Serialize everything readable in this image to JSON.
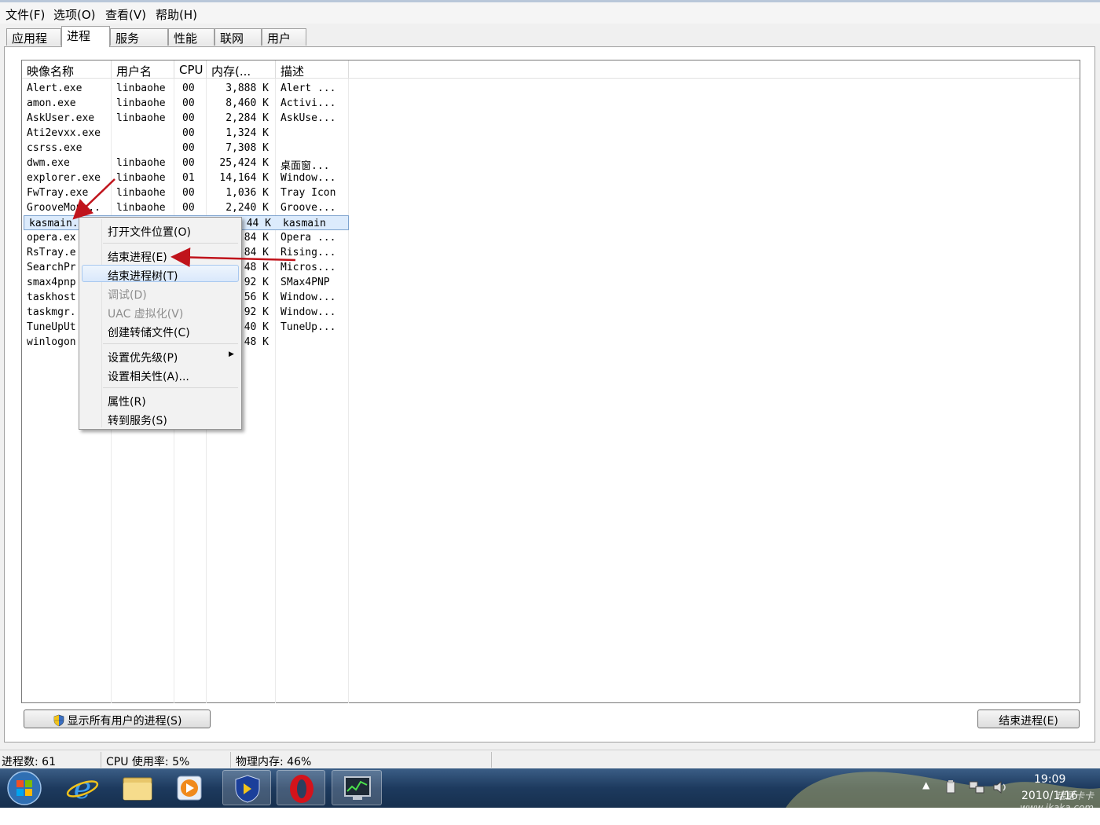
{
  "menubar": {
    "file": "文件(F)",
    "options": "选项(O)",
    "view": "查看(V)",
    "help": "帮助(H)"
  },
  "tabs": [
    {
      "label": "应用程序"
    },
    {
      "label": "进程",
      "active": true
    },
    {
      "label": "服务"
    },
    {
      "label": "性能"
    },
    {
      "label": "联网"
    },
    {
      "label": "用户"
    }
  ],
  "table": {
    "columns": [
      "映像名称",
      "用户名",
      "CPU",
      "内存(...",
      "描述"
    ],
    "rows": [
      {
        "name": "Alert.exe",
        "user": "linbaohe",
        "cpu": "00",
        "mem": "3,888 K",
        "desc": "Alert ..."
      },
      {
        "name": "amon.exe",
        "user": "linbaohe",
        "cpu": "00",
        "mem": "8,460 K",
        "desc": "Activi..."
      },
      {
        "name": "AskUser.exe",
        "user": "linbaohe",
        "cpu": "00",
        "mem": "2,284 K",
        "desc": "AskUse..."
      },
      {
        "name": "Ati2evxx.exe",
        "user": "",
        "cpu": "00",
        "mem": "1,324 K",
        "desc": ""
      },
      {
        "name": "csrss.exe",
        "user": "",
        "cpu": "00",
        "mem": "7,308 K",
        "desc": ""
      },
      {
        "name": "dwm.exe",
        "user": "linbaohe",
        "cpu": "00",
        "mem": "25,424 K",
        "desc": "桌面窗..."
      },
      {
        "name": "explorer.exe",
        "user": "linbaohe",
        "cpu": "01",
        "mem": "14,164 K",
        "desc": "Window..."
      },
      {
        "name": "FwTray.exe",
        "user": "linbaohe",
        "cpu": "00",
        "mem": "1,036 K",
        "desc": "Tray Icon"
      },
      {
        "name": "GrooveMon...",
        "user": "linbaohe",
        "cpu": "00",
        "mem": "2,240 K",
        "desc": "Groove..."
      },
      {
        "name": "kasmain.",
        "user": "",
        "cpu": "",
        "mem": "44 K",
        "desc": "kasmain",
        "selected": true
      },
      {
        "name": "opera.ex",
        "user": "",
        "cpu": "",
        "mem": "84 K",
        "desc": "Opera ..."
      },
      {
        "name": "RsTray.e",
        "user": "",
        "cpu": "",
        "mem": "84 K",
        "desc": "Rising..."
      },
      {
        "name": "SearchPr",
        "user": "",
        "cpu": "",
        "mem": "48 K",
        "desc": "Micros..."
      },
      {
        "name": "smax4pnp",
        "user": "",
        "cpu": "",
        "mem": "92 K",
        "desc": "SMax4PNP"
      },
      {
        "name": "taskhost",
        "user": "",
        "cpu": "",
        "mem": "56 K",
        "desc": "Window..."
      },
      {
        "name": "taskmgr.",
        "user": "",
        "cpu": "",
        "mem": "92 K",
        "desc": "Window..."
      },
      {
        "name": "TuneUpUt",
        "user": "",
        "cpu": "",
        "mem": "40 K",
        "desc": "TuneUp..."
      },
      {
        "name": "winlogon",
        "user": "",
        "cpu": "",
        "mem": "48 K",
        "desc": ""
      }
    ]
  },
  "context_menu": {
    "items": [
      {
        "label": "打开文件位置(O)"
      },
      {
        "label": "结束进程(E)"
      },
      {
        "label": "结束进程树(T)",
        "highlighted": true
      },
      {
        "label": "调试(D)",
        "disabled": true
      },
      {
        "label": "UAC 虚拟化(V)",
        "disabled": true
      },
      {
        "label": "创建转储文件(C)"
      },
      {
        "label": "设置优先级(P)",
        "submenu": true
      },
      {
        "label": "设置相关性(A)..."
      },
      {
        "label": "属性(R)"
      },
      {
        "label": "转到服务(S)"
      }
    ]
  },
  "buttons": {
    "show_all": "显示所有用户的进程(S)",
    "end_process": "结束进程(E)"
  },
  "statusbar": {
    "processes": "进程数: 61",
    "cpu": "CPU 使用率: 5%",
    "memory": "物理内存: 46%"
  },
  "tray": {
    "time": "19:09",
    "date": "2010/1/16"
  },
  "watermark": "瑞星卡卡 www.ikaka.com",
  "colors": {
    "annotation_arrow": "#c0141c",
    "selection": "#dcebfc",
    "taskbar": "#1d3a5e"
  }
}
